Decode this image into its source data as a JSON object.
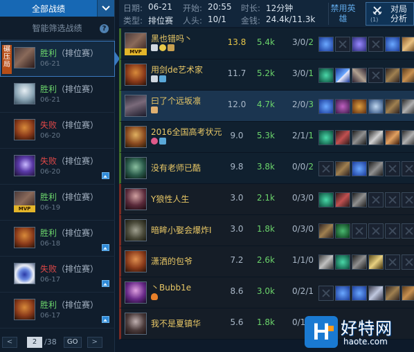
{
  "sidebar": {
    "title": "全部战绩",
    "filter": "智能筛选战绩",
    "help": "?",
    "badge_text": "碾压局",
    "mvp_text": "MVP",
    "matches": [
      {
        "result": "胜利",
        "type": "（排位赛）",
        "date": "06-21"
      },
      {
        "result": "胜利",
        "type": "（排位赛）",
        "date": "06-21"
      },
      {
        "result": "失败",
        "type": "（排位赛）",
        "date": "06-20"
      },
      {
        "result": "失败",
        "type": "（排位赛）",
        "date": "06-20"
      },
      {
        "result": "胜利",
        "type": "（排位赛）",
        "date": "06-19"
      },
      {
        "result": "胜利",
        "type": "（排位赛）",
        "date": "06-18"
      },
      {
        "result": "失败",
        "type": "（排位赛）",
        "date": "06-17"
      },
      {
        "result": "胜利",
        "type": "（排位赛）",
        "date": "06-17"
      }
    ],
    "pager": {
      "prev": "<",
      "page": "2",
      "total": "/38",
      "go": "GO",
      "next": ">"
    }
  },
  "header": {
    "date_label": "日期:",
    "date": "06-21",
    "start_label": "开始:",
    "start": "20:55",
    "duration_label": "时长:",
    "duration": "12分钟",
    "type_label": "类型:",
    "type": "排位赛",
    "players_label": "人头:",
    "players": "10/1",
    "gold_label": "金钱:",
    "gold": "24.4k/11.3k",
    "ban_button": "禁用英雄",
    "analysis_button": "对局分析",
    "analysis_sub": "(1)"
  },
  "players": [
    {
      "name": "黑也错吗丶",
      "score": "13.8",
      "gold": "5.4k",
      "kda": "3/0/",
      "kda_last": "2",
      "mvp": "MVP"
    },
    {
      "name": "用剑de艺术家",
      "score": "11.7",
      "gold": "5.2k",
      "kda": "3/0/",
      "kda_last": "1"
    },
    {
      "name": "曰了个远坂凛",
      "score": "12.0",
      "gold": "4.7k",
      "kda": "2/0/",
      "kda_last": "3"
    },
    {
      "name": "2016全国高考状元",
      "score": "9.0",
      "gold": "5.3k",
      "kda": "2/1/",
      "kda_last": "1"
    },
    {
      "name": "没有老师已酷",
      "score": "9.8",
      "gold": "3.8k",
      "kda": "0/0/",
      "kda_last": "2"
    },
    {
      "name": "Y狼性人生",
      "score": "3.0",
      "gold": "2.1k",
      "kda": "0/3/0",
      "kda_last": ""
    },
    {
      "name": "暗眸小娶会爆炸I",
      "score": "3.0",
      "gold": "1.8k",
      "kda": "0/3/0",
      "kda_last": ""
    },
    {
      "name": "潇洒的包爷",
      "score": "7.2",
      "gold": "2.6k",
      "kda": "1/1/0",
      "kda_last": ""
    },
    {
      "name": "丶Bubb1e",
      "score": "8.6",
      "gold": "3.0k",
      "kda": "0/2/1",
      "kda_last": ""
    },
    {
      "name": "我不是夏镇华",
      "score": "5.6",
      "gold": "1.8k",
      "kda": "0/1/0",
      "kda_last": ""
    }
  ],
  "watermark": {
    "name": "好特网",
    "url": "haote.com",
    "logo": "H"
  },
  "colors": {
    "win": "#6bd46b",
    "lose": "#e04848",
    "accent": "#1768b4",
    "gold": "#e8c766"
  }
}
